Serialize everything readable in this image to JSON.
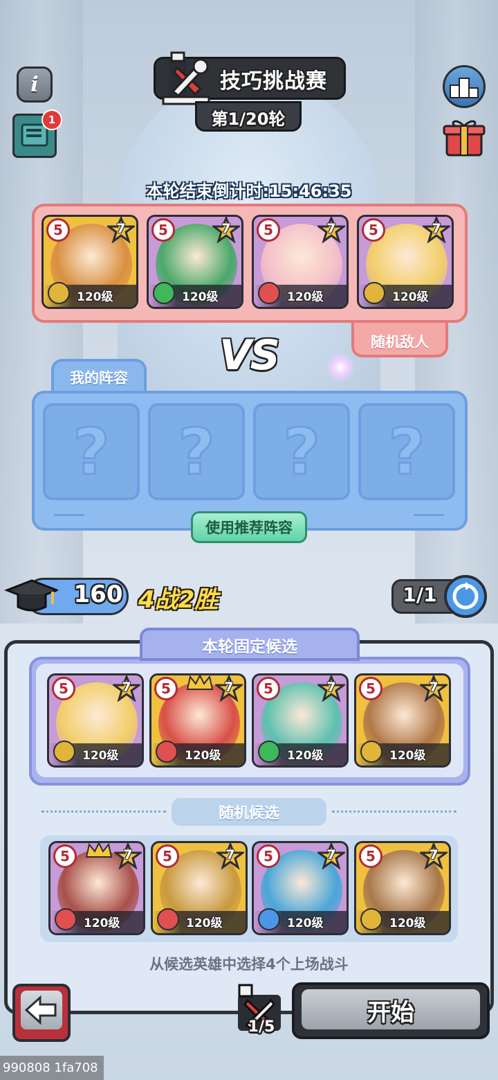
{
  "header": {
    "title": "技巧挑战赛",
    "round": "第1/20轮",
    "countdown": "本轮结束倒计时:15:46:35",
    "notification_count": "1"
  },
  "enemy": {
    "tab_label": "随机敌人",
    "heroes": [
      {
        "grade": "5",
        "stars": "7",
        "level": "120级",
        "element_color": "#e0b53a",
        "face_color": "#d89040",
        "frame": "#f0c040"
      },
      {
        "grade": "5",
        "stars": "7",
        "level": "120级",
        "element_color": "#3fb85a",
        "face_color": "#4aa86a",
        "frame": "#c79ad8"
      },
      {
        "grade": "5",
        "stars": "7",
        "level": "120级",
        "element_color": "#e05050",
        "face_color": "#f3c0c8",
        "frame": "#c79ad8"
      },
      {
        "grade": "5",
        "stars": "7",
        "level": "120级",
        "element_color": "#e0b53a",
        "face_color": "#f2cf6a",
        "frame": "#c79ad8"
      }
    ]
  },
  "vs_label": "VS",
  "my_team": {
    "tab_label": "我的阵容",
    "slots": [
      "?",
      "?",
      "?",
      "?"
    ],
    "recommend_button": "使用推荐阵容"
  },
  "stats": {
    "capacity": "160",
    "record": "4战2胜",
    "refresh": "1/1"
  },
  "candidates": {
    "fixed_header": "本轮固定候选",
    "fixed": [
      {
        "grade": "5",
        "stars": "7",
        "level": "120级",
        "element_color": "#e0b53a",
        "face_color": "#f2cf6a",
        "frame": "#c79ad8",
        "crown": false
      },
      {
        "grade": "5",
        "stars": "7",
        "level": "120级",
        "element_color": "#e05050",
        "face_color": "#d85048",
        "frame": "#f0c040",
        "crown": true
      },
      {
        "grade": "5",
        "stars": "7",
        "level": "120级",
        "element_color": "#3fb85a",
        "face_color": "#5ec0b0",
        "frame": "#c79ad8",
        "crown": false
      },
      {
        "grade": "5",
        "stars": "7",
        "level": "120级",
        "element_color": "#e0b53a",
        "face_color": "#b07848",
        "frame": "#f0c040",
        "crown": false
      }
    ],
    "random_header": "随机候选",
    "random": [
      {
        "grade": "5",
        "stars": "7",
        "level": "120级",
        "element_color": "#e05050",
        "face_color": "#a8504a",
        "frame": "#c79ad8",
        "crown": true
      },
      {
        "grade": "5",
        "stars": "7",
        "level": "120级",
        "element_color": "#e05050",
        "face_color": "#c89a40",
        "frame": "#f0c040",
        "crown": false
      },
      {
        "grade": "5",
        "stars": "7",
        "level": "120级",
        "element_color": "#4b97e6",
        "face_color": "#4aa6d8",
        "frame": "#c79ad8",
        "crown": false
      },
      {
        "grade": "5",
        "stars": "7",
        "level": "120级",
        "element_color": "#e0b53a",
        "face_color": "#a8784a",
        "frame": "#f0c040",
        "crown": false
      }
    ],
    "hint": "从候选英雄中选择4个上场战斗"
  },
  "footer": {
    "start_button": "开始",
    "tickets": "1/5",
    "uid": "990808 1fa708"
  }
}
